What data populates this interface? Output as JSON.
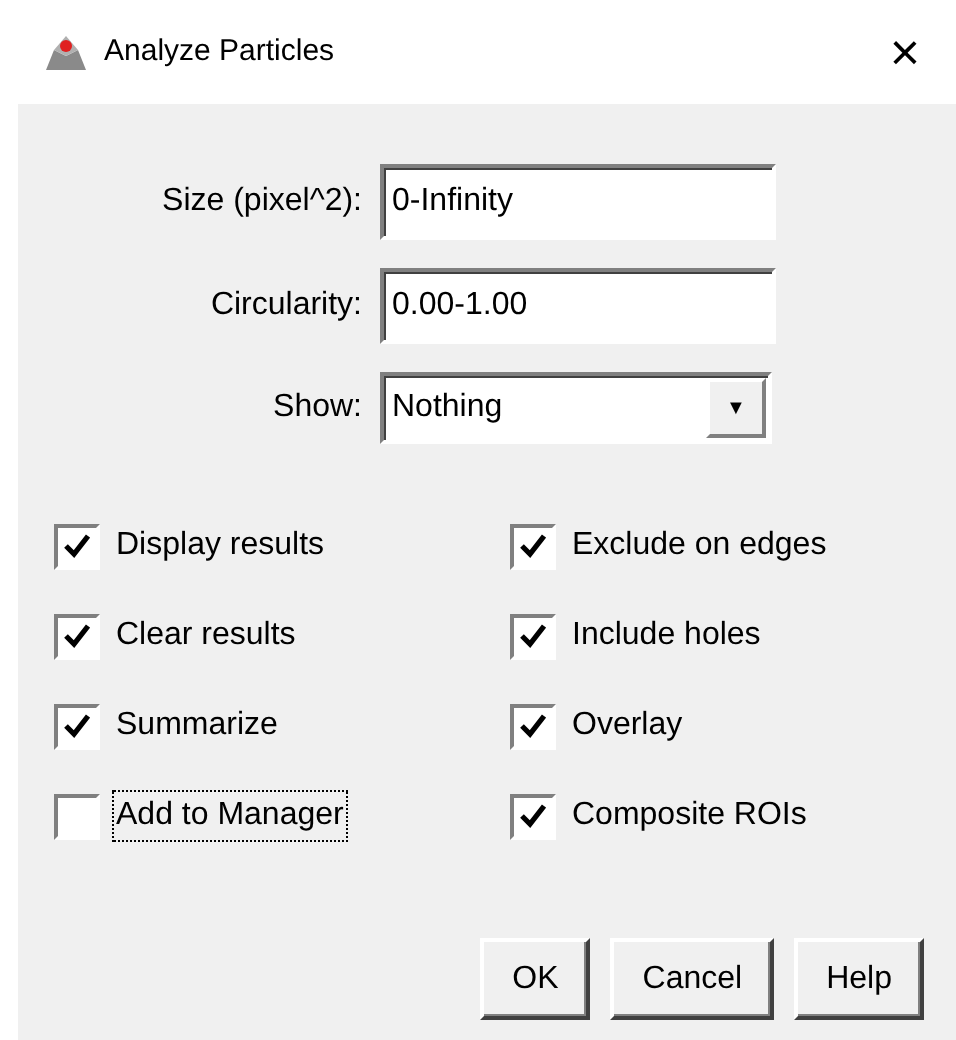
{
  "window": {
    "title": "Analyze Particles",
    "close": "×"
  },
  "fields": [
    {
      "label": "Size (pixel^2):",
      "value": "0-Infinity"
    },
    {
      "label": "Circularity:",
      "value": "0.00-1.00"
    }
  ],
  "show": {
    "label": "Show:",
    "value": "Nothing",
    "arrow": "▼"
  },
  "checkboxes": [
    {
      "label": "Display results",
      "checked": true,
      "focused": false
    },
    {
      "label": "Exclude on edges",
      "checked": true,
      "focused": false
    },
    {
      "label": "Clear results",
      "checked": true,
      "focused": false
    },
    {
      "label": "Include holes",
      "checked": true,
      "focused": false
    },
    {
      "label": "Summarize",
      "checked": true,
      "focused": false
    },
    {
      "label": "Overlay",
      "checked": true,
      "focused": false
    },
    {
      "label": "Add to Manager",
      "checked": false,
      "focused": true
    },
    {
      "label": "Composite ROIs",
      "checked": true,
      "focused": false
    }
  ],
  "buttons": [
    "OK",
    "Cancel",
    "Help"
  ]
}
